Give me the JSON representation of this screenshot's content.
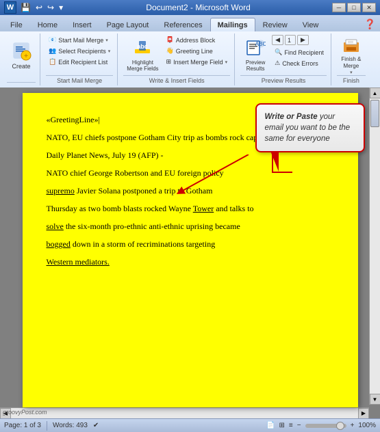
{
  "titleBar": {
    "title": "Document2 - Microsoft Word",
    "minimize": "─",
    "maximize": "□",
    "close": "✕"
  },
  "quickAccess": {
    "buttons": [
      "💾",
      "↩",
      "↪",
      "⊞"
    ]
  },
  "tabs": [
    {
      "label": "File",
      "active": false
    },
    {
      "label": "Home",
      "active": false
    },
    {
      "label": "Insert",
      "active": false
    },
    {
      "label": "Page Layout",
      "active": false
    },
    {
      "label": "References",
      "active": false
    },
    {
      "label": "Mailings",
      "active": true
    },
    {
      "label": "Review",
      "active": false
    },
    {
      "label": "View",
      "active": false
    }
  ],
  "ribbon": {
    "groups": [
      {
        "label": "Start Mail Merge",
        "buttons": [
          {
            "label": "Create",
            "icon": "📋",
            "size": "large"
          },
          {
            "label": "Start Mail Merge ▾",
            "icon": "📧",
            "size": "small"
          },
          {
            "label": "Select Recipients ▾",
            "icon": "👥",
            "size": "small"
          },
          {
            "label": "Edit Recipient List",
            "icon": "📋",
            "size": "small"
          }
        ]
      },
      {
        "label": "Write & Insert Fields",
        "buttons": [
          {
            "label": "Highlight\nMerge Fields",
            "icon": "🖊",
            "size": "large"
          },
          {
            "label": "Address Block",
            "icon": "📮",
            "size": "small"
          },
          {
            "label": "Greeting Line",
            "icon": "👋",
            "size": "small"
          },
          {
            "label": "Insert Merge Field ▾",
            "icon": "⊞",
            "size": "small"
          }
        ]
      },
      {
        "label": "Preview Results",
        "buttons": [
          {
            "label": "Preview\nResults",
            "icon": "👁",
            "size": "large"
          },
          {
            "label": "◀",
            "size": "nav"
          },
          {
            "label": "1",
            "size": "nav"
          },
          {
            "label": "▶",
            "size": "nav"
          },
          {
            "label": "Find Recipient",
            "size": "small"
          },
          {
            "label": "Check Errors",
            "size": "small"
          }
        ]
      },
      {
        "label": "Finish",
        "buttons": [
          {
            "label": "Finish &\nMerge ▾",
            "icon": "🖨",
            "size": "large"
          }
        ]
      }
    ]
  },
  "document": {
    "greetingLine": "«GreetingLine»",
    "paragraphs": [
      "NATO, EU chiefs postpone Gotham City trip as bombs rock capital transit center",
      "Daily Planet News, July 19 (AFP) -",
      "NATO chief George Robertson and EU foreign policy",
      "supremo Javier Solana postponed a trip to Gotham",
      "Thursday as two bomb blasts rocked Wayne Tower and talks to",
      "solve the six-month pro-ethnic anti-ethnic uprising became",
      "bogged down in a storm of recriminations targeting",
      "Western mediators."
    ],
    "underlinedWords": [
      "supremo",
      "solve",
      "bogged",
      "Western mediators."
    ],
    "callout": {
      "text1": "Write or Paste",
      "text2": " your email you want to be the same for everyone"
    }
  },
  "statusBar": {
    "page": "Page: 1 of 3",
    "words": "Words: 493",
    "zoom": "100%",
    "icons": [
      "📄",
      "✉",
      "📊",
      "📄",
      "📄",
      "📄"
    ]
  }
}
